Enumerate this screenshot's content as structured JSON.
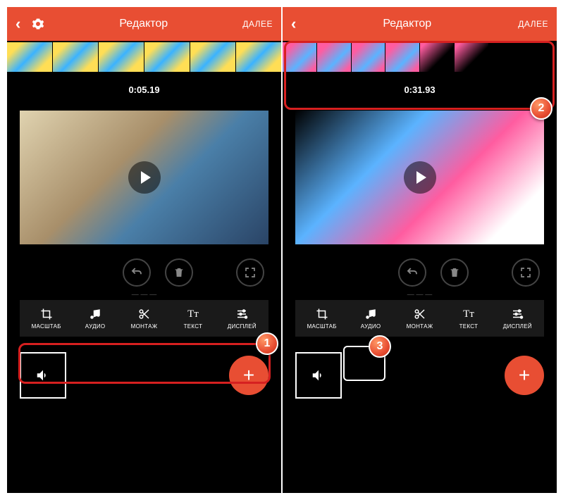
{
  "left": {
    "header": {
      "title": "Редактор",
      "next": "ДАЛЕЕ"
    },
    "timestamp": "0:05.19",
    "tools": [
      {
        "label": "МАСШТАБ",
        "icon": "crop"
      },
      {
        "label": "АУДИО",
        "icon": "music"
      },
      {
        "label": "МОНТАЖ",
        "icon": "cut"
      },
      {
        "label": "ТЕКСТ",
        "icon": "text"
      },
      {
        "label": "ДИСПЛЕЙ",
        "icon": "sliders"
      }
    ],
    "badge": "1"
  },
  "right": {
    "header": {
      "title": "Редактор",
      "next": "ДАЛЕЕ"
    },
    "timestamp": "0:31.93",
    "tools": [
      {
        "label": "МАСШТАБ",
        "icon": "crop"
      },
      {
        "label": "АУДИО",
        "icon": "music"
      },
      {
        "label": "МОНТАЖ",
        "icon": "cut"
      },
      {
        "label": "ТЕКСТ",
        "icon": "text"
      },
      {
        "label": "ДИСПЛЕЙ",
        "icon": "sliders"
      }
    ],
    "badge_timeline": "2",
    "badge_audio": "3"
  },
  "icons": {
    "undo": "↶",
    "trash": "🗑",
    "fullscreen": "⛶",
    "speaker": "🔊",
    "plus": "+"
  }
}
